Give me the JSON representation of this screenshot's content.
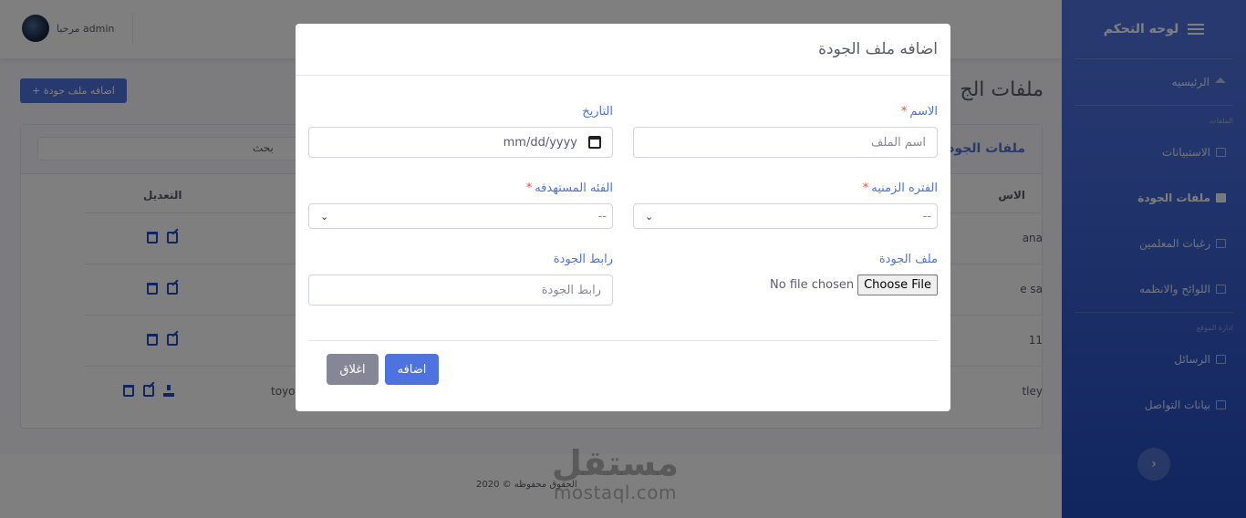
{
  "sidebar": {
    "brand": "لوحه التحكم",
    "items": {
      "home": "الرئيسيه",
      "surveys": "الاستبيانات",
      "quality_files": "ملفات الجودة",
      "teacher_wishes": "رغبات المعلمين",
      "regulations": "اللوائح والانظمه",
      "messages": "الرسائل",
      "contact_info": "بيانات التواصل"
    },
    "headings": {
      "section1": "الملفات",
      "section2": "ادارة الموقع"
    },
    "toggle_icon": "chevron-left-icon"
  },
  "topbar": {
    "greeting": "مرحبا admin"
  },
  "page": {
    "add_button": "+ اضافه ملف جودة",
    "title": "ملفات الج",
    "card_title": "ملفات الجود",
    "search_label": "بحث",
    "col_edit": "التعديل",
    "col_name": "الاس",
    "rows": [
      {
        "right": "ana",
        "left": ""
      },
      {
        "right": "e sa",
        "left": ""
      },
      {
        "right": "11",
        "left": ""
      },
      {
        "right": "tley",
        "left": "toyo"
      }
    ]
  },
  "footer": {
    "copyright": "الحقوق محفوظه © 2020"
  },
  "watermark": {
    "arabic": "مستقل",
    "latin": "mostaql.com"
  },
  "modal": {
    "title": "اضافه ملف الجودة",
    "name_label": "الاسم",
    "name_placeholder": "اسم الملف",
    "date_label": "التاريخ",
    "date_placeholder": "mm/dd/yyyy",
    "period_label": "الفتره الزمنيه",
    "period_value": "--",
    "target_label": "الفئه المستهدفه",
    "target_value": "--",
    "file_label": "ملف الجودة",
    "file_button": "Choose File",
    "file_status": "No file chosen",
    "link_label": "رابط الجودة",
    "link_placeholder": "رابط الجودة",
    "submit": "اضافه",
    "close": "اغلاق",
    "required_mark": "*"
  },
  "colors": {
    "primary": "#4e73df",
    "sidebar_dark": "#224abe",
    "secondary": "#858796",
    "danger": "#e74a3b"
  }
}
